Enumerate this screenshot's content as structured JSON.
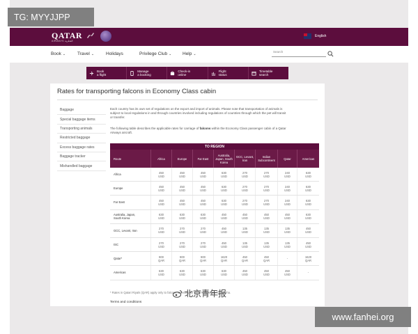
{
  "watermarks": {
    "top_left": "TG: MYYJJPP",
    "center": "北京青年报",
    "bottom_right": "www.fanhei.org"
  },
  "header": {
    "logo": "QATAR",
    "logo_sub": "AIRWAYS القطرية",
    "language": "English",
    "colors": {
      "brand": "#5c0d3d",
      "brand_light": "#6b1a47"
    }
  },
  "nav": {
    "items": [
      {
        "label": "Book",
        "dropdown": true
      },
      {
        "label": "Travel",
        "dropdown": true
      },
      {
        "label": "Holidays",
        "dropdown": false
      },
      {
        "label": "Privilege Club",
        "dropdown": true
      },
      {
        "label": "Help",
        "dropdown": true
      }
    ],
    "search_placeholder": "Search"
  },
  "quick_links": [
    {
      "label": "Book\na flight",
      "icon": "plane-icon"
    },
    {
      "label": "Manage\na booking",
      "icon": "phone-icon"
    },
    {
      "label": "Check-in\nonline",
      "icon": "checkin-icon"
    },
    {
      "label": "Flight\nstatus",
      "icon": "status-icon"
    },
    {
      "label": "Timetable\nsearch",
      "icon": "calendar-icon"
    }
  ],
  "page": {
    "title": "Rates for transporting falcons in Economy Class cabin"
  },
  "sidebar": {
    "items": [
      "Baggage",
      "Special baggage items",
      "Transporting animals",
      "Restricted baggage",
      "Excess baggage rates",
      "Baggage tracker",
      "Mishandled baggage"
    ]
  },
  "intro": {
    "p1": "Each country has its own set of regulations on the export and import of animals. Please note that transportation of animals is subject to local regulations in and through which the pet will transit or transfer.",
    "p1_line1": "Each country has its own set of regulations on the export and import of animals. Please note that transportation of animals is",
    "p1_line2": "subject to local regulations in and through countries involved including regulations of countries through which the pet will transit",
    "p1_line3": "or transfer.",
    "p2_before": "The following table describes the applicable rates for carriage of ",
    "p2_bold": "falcons",
    "p2_after": " within the Economy Class passenger cabin of a Qatar",
    "p2_line2": "Airways aircraft."
  },
  "table": {
    "to_region": "TO REGION",
    "headers": [
      "Route",
      "Africa",
      "Europe",
      "Far East",
      "Australia, Japan, South Korea",
      "GCC, Levant, Iran",
      "Indian Subcontinent",
      "Qatar",
      "Americas"
    ],
    "rows": [
      {
        "route": "Africa",
        "values": [
          "450\nUSD",
          "450\nUSD",
          "450\nUSD",
          "630\nUSD",
          "270\nUSD",
          "270\nUSD",
          "240\nUSD",
          "630\nUSD"
        ]
      },
      {
        "route": "Europe",
        "values": [
          "450\nUSD",
          "450\nUSD",
          "450\nUSD",
          "630\nUSD",
          "270\nUSD",
          "270\nUSD",
          "240\nUSD",
          "630\nUSD"
        ]
      },
      {
        "route": "Far East",
        "values": [
          "450\nUSD",
          "450\nUSD",
          "450\nUSD",
          "630\nUSD",
          "270\nUSD",
          "270\nUSD",
          "240\nUSD",
          "630\nUSD"
        ]
      },
      {
        "route": "Australia, Japan,\nSouth Korea",
        "values": [
          "630\nUSD",
          "630\nUSD",
          "630\nUSD",
          "450\nUSD",
          "450\nUSD",
          "450\nUSD",
          "450\nUSD",
          "630\nUSD"
        ]
      },
      {
        "route": "GCC, Levant, Iran",
        "values": [
          "270\nUSD",
          "270\nUSD",
          "270\nUSD",
          "450\nUSD",
          "135\nUSD",
          "135\nUSD",
          "135\nUSD",
          "450\nUSD"
        ]
      },
      {
        "route": "ISC",
        "values": [
          "270\nUSD",
          "270\nUSD",
          "270\nUSD",
          "450\nUSD",
          "135\nUSD",
          "135\nUSD",
          "135\nUSD",
          "450\nUSD"
        ]
      },
      {
        "route": "Qatar*",
        "values": [
          "900\nQAR",
          "900\nQAR",
          "900\nQAR",
          "1620\nQAR",
          "450\nQAR",
          "450\nQAR",
          "-",
          "1620\nQAR"
        ]
      },
      {
        "route": "Americas",
        "values": [
          "630\nUSD",
          "630\nUSD",
          "630\nUSD",
          "630\nUSD",
          "450\nUSD",
          "450\nUSD",
          "450\nUSD",
          "-"
        ]
      }
    ]
  },
  "footnote": "* Rates in Qatari Riyals (QAR) apply only to falcons travelling for travel originating from Doha.",
  "terms": "Terms and conditions"
}
